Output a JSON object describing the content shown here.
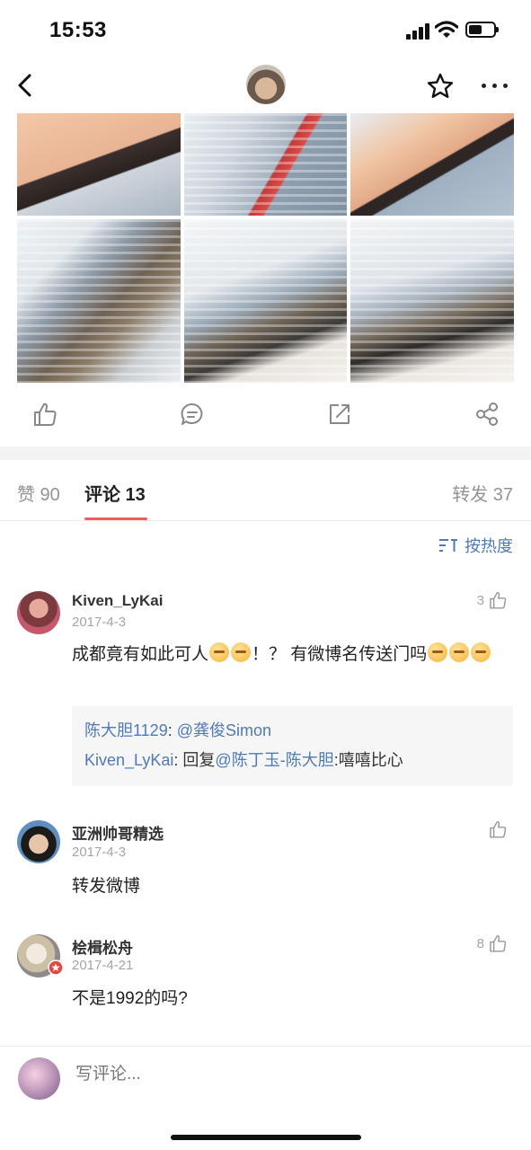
{
  "status_bar": {
    "time": "15:53"
  },
  "tabs": [
    {
      "label": "赞 90"
    },
    {
      "label": "评论 13"
    },
    {
      "label": "转发 37"
    }
  ],
  "sort": {
    "label": "按热度"
  },
  "comments": [
    {
      "username": "Kiven_LyKai",
      "date": "2017-4-3",
      "likes": "3",
      "text": "成都竟有如此可人",
      "text_middle": "！？ 有微博名传送门吗",
      "replies": [
        {
          "author": "陈大胆1129",
          "sep": ": ",
          "mention": "@龚俊Simon",
          "content": ""
        },
        {
          "author": "Kiven_LyKai",
          "sep": ": 回复",
          "mention": "@陈丁玉-陈大胆",
          "content": ":嘻嘻比心"
        }
      ]
    },
    {
      "username": "亚洲帅哥精选",
      "date": "2017-4-3",
      "likes": "",
      "text": "转发微博"
    },
    {
      "username": "桧楫松舟",
      "date": "2017-4-21",
      "likes": "8",
      "text": "不是1992的吗?"
    }
  ],
  "bottom_bar": {
    "placeholder": "写评论..."
  },
  "colors": {
    "accent_red": "#f25b5b",
    "link_blue": "#4f7ab8"
  }
}
